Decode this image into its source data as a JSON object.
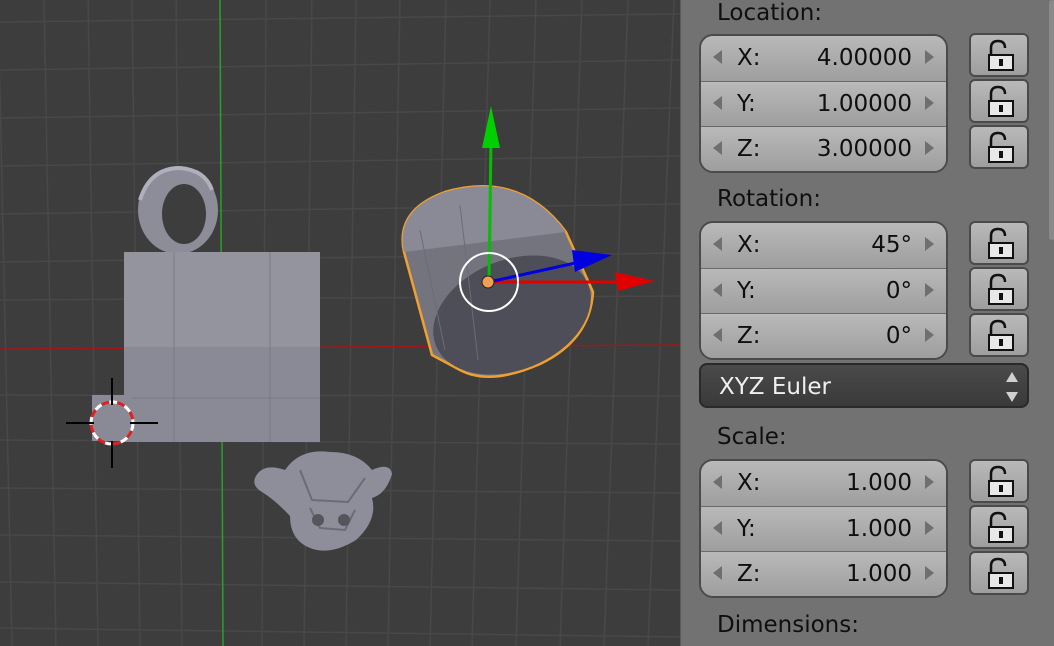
{
  "viewport": {
    "objects": [
      "torus",
      "cube",
      "cylinder",
      "monkey",
      "3d-cursor"
    ],
    "colors": {
      "background": "#3d3d3d",
      "x_axis": "#e00000",
      "y_axis": "#00c000",
      "z_axis": "#0000e0",
      "selection": "#f0a030"
    }
  },
  "panel": {
    "location": {
      "label": "Location:",
      "fields": [
        {
          "axis": "X:",
          "value": "4.00000"
        },
        {
          "axis": "Y:",
          "value": "1.00000"
        },
        {
          "axis": "Z:",
          "value": "3.00000"
        }
      ]
    },
    "rotation": {
      "label": "Rotation:",
      "fields": [
        {
          "axis": "X:",
          "value": "45°"
        },
        {
          "axis": "Y:",
          "value": "0°"
        },
        {
          "axis": "Z:",
          "value": "0°"
        }
      ],
      "mode": "XYZ Euler"
    },
    "scale": {
      "label": "Scale:",
      "fields": [
        {
          "axis": "X:",
          "value": "1.000"
        },
        {
          "axis": "Y:",
          "value": "1.000"
        },
        {
          "axis": "Z:",
          "value": "1.000"
        }
      ]
    },
    "dimensions": {
      "label": "Dimensions:"
    },
    "icons": {
      "lock": "lock-open-icon",
      "spinner": "up-down-arrows-icon"
    }
  }
}
